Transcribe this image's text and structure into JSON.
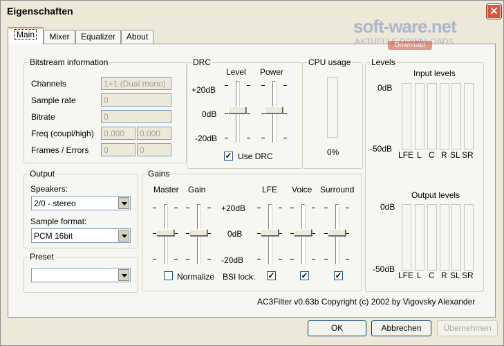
{
  "window": {
    "title": "Eigenschaften",
    "close_glyph": "✕"
  },
  "tabs": [
    {
      "label": "Main",
      "active": true
    },
    {
      "label": "Mixer",
      "active": false
    },
    {
      "label": "Equalizer",
      "active": false
    },
    {
      "label": "About",
      "active": false
    }
  ],
  "bitstream": {
    "title": "Bitstream information",
    "channels_label": "Channels",
    "channels_value": "1+1 (Dual mono)",
    "sample_rate_label": "Sample rate",
    "sample_rate_value": "0",
    "bitrate_label": "Bitrate",
    "bitrate_value": "0",
    "freq_label": "Freq (coupl/high)",
    "freq_coupl_value": "0.000",
    "freq_high_value": "0.000",
    "frames_label": "Frames / Errors",
    "frames_value": "0",
    "errors_value": "0"
  },
  "drc": {
    "title": "DRC",
    "level_label": "Level",
    "power_label": "Power",
    "scale_top": "+20dB",
    "scale_mid": "0dB",
    "scale_bottom": "-20dB",
    "use_drc_label": "Use DRC",
    "use_drc_checked": true,
    "check_glyph": "✓"
  },
  "cpu": {
    "title": "CPU usage",
    "value": "0%"
  },
  "levels": {
    "title": "Levels",
    "input_title": "Input levels",
    "output_title": "Output levels",
    "top_db": "0dB",
    "bottom_db": "-50dB",
    "channels": [
      "LFE",
      "L",
      "C",
      "R",
      "SL",
      "SR"
    ]
  },
  "output": {
    "title": "Output",
    "speakers_label": "Speakers:",
    "speakers_value": "2/0 - stereo",
    "format_label": "Sample format:",
    "format_value": "PCM 16bit"
  },
  "preset": {
    "title": "Preset",
    "value": ""
  },
  "gains": {
    "title": "Gains",
    "master_label": "Master",
    "gain_label": "Gain",
    "lfe_label": "LFE",
    "voice_label": "Voice",
    "surround_label": "Surround",
    "scale_top": "+20dB",
    "scale_mid": "0dB",
    "scale_bottom": "-20dB",
    "normalize_label": "Normalize",
    "normalize_checked": false,
    "bsi_lock_label": "BSI lock:",
    "bsi_lock_checked": true,
    "voice_checked": true,
    "surround_checked": true,
    "check_glyph": "✓"
  },
  "copyright": "AC3Filter v0.63b Copyright (c) 2002 by Vigovsky Alexander",
  "buttons": {
    "ok": "OK",
    "cancel": "Abbrechen",
    "apply": "Übernehmen"
  },
  "watermark": {
    "line1": "soft-ware.net",
    "line2": "AKTUELLE DOWNLOADS",
    "badge": "Download"
  },
  "colors": {
    "close": "#d9553d",
    "tab_active": "#e68b2c",
    "border": "#919b9c"
  }
}
